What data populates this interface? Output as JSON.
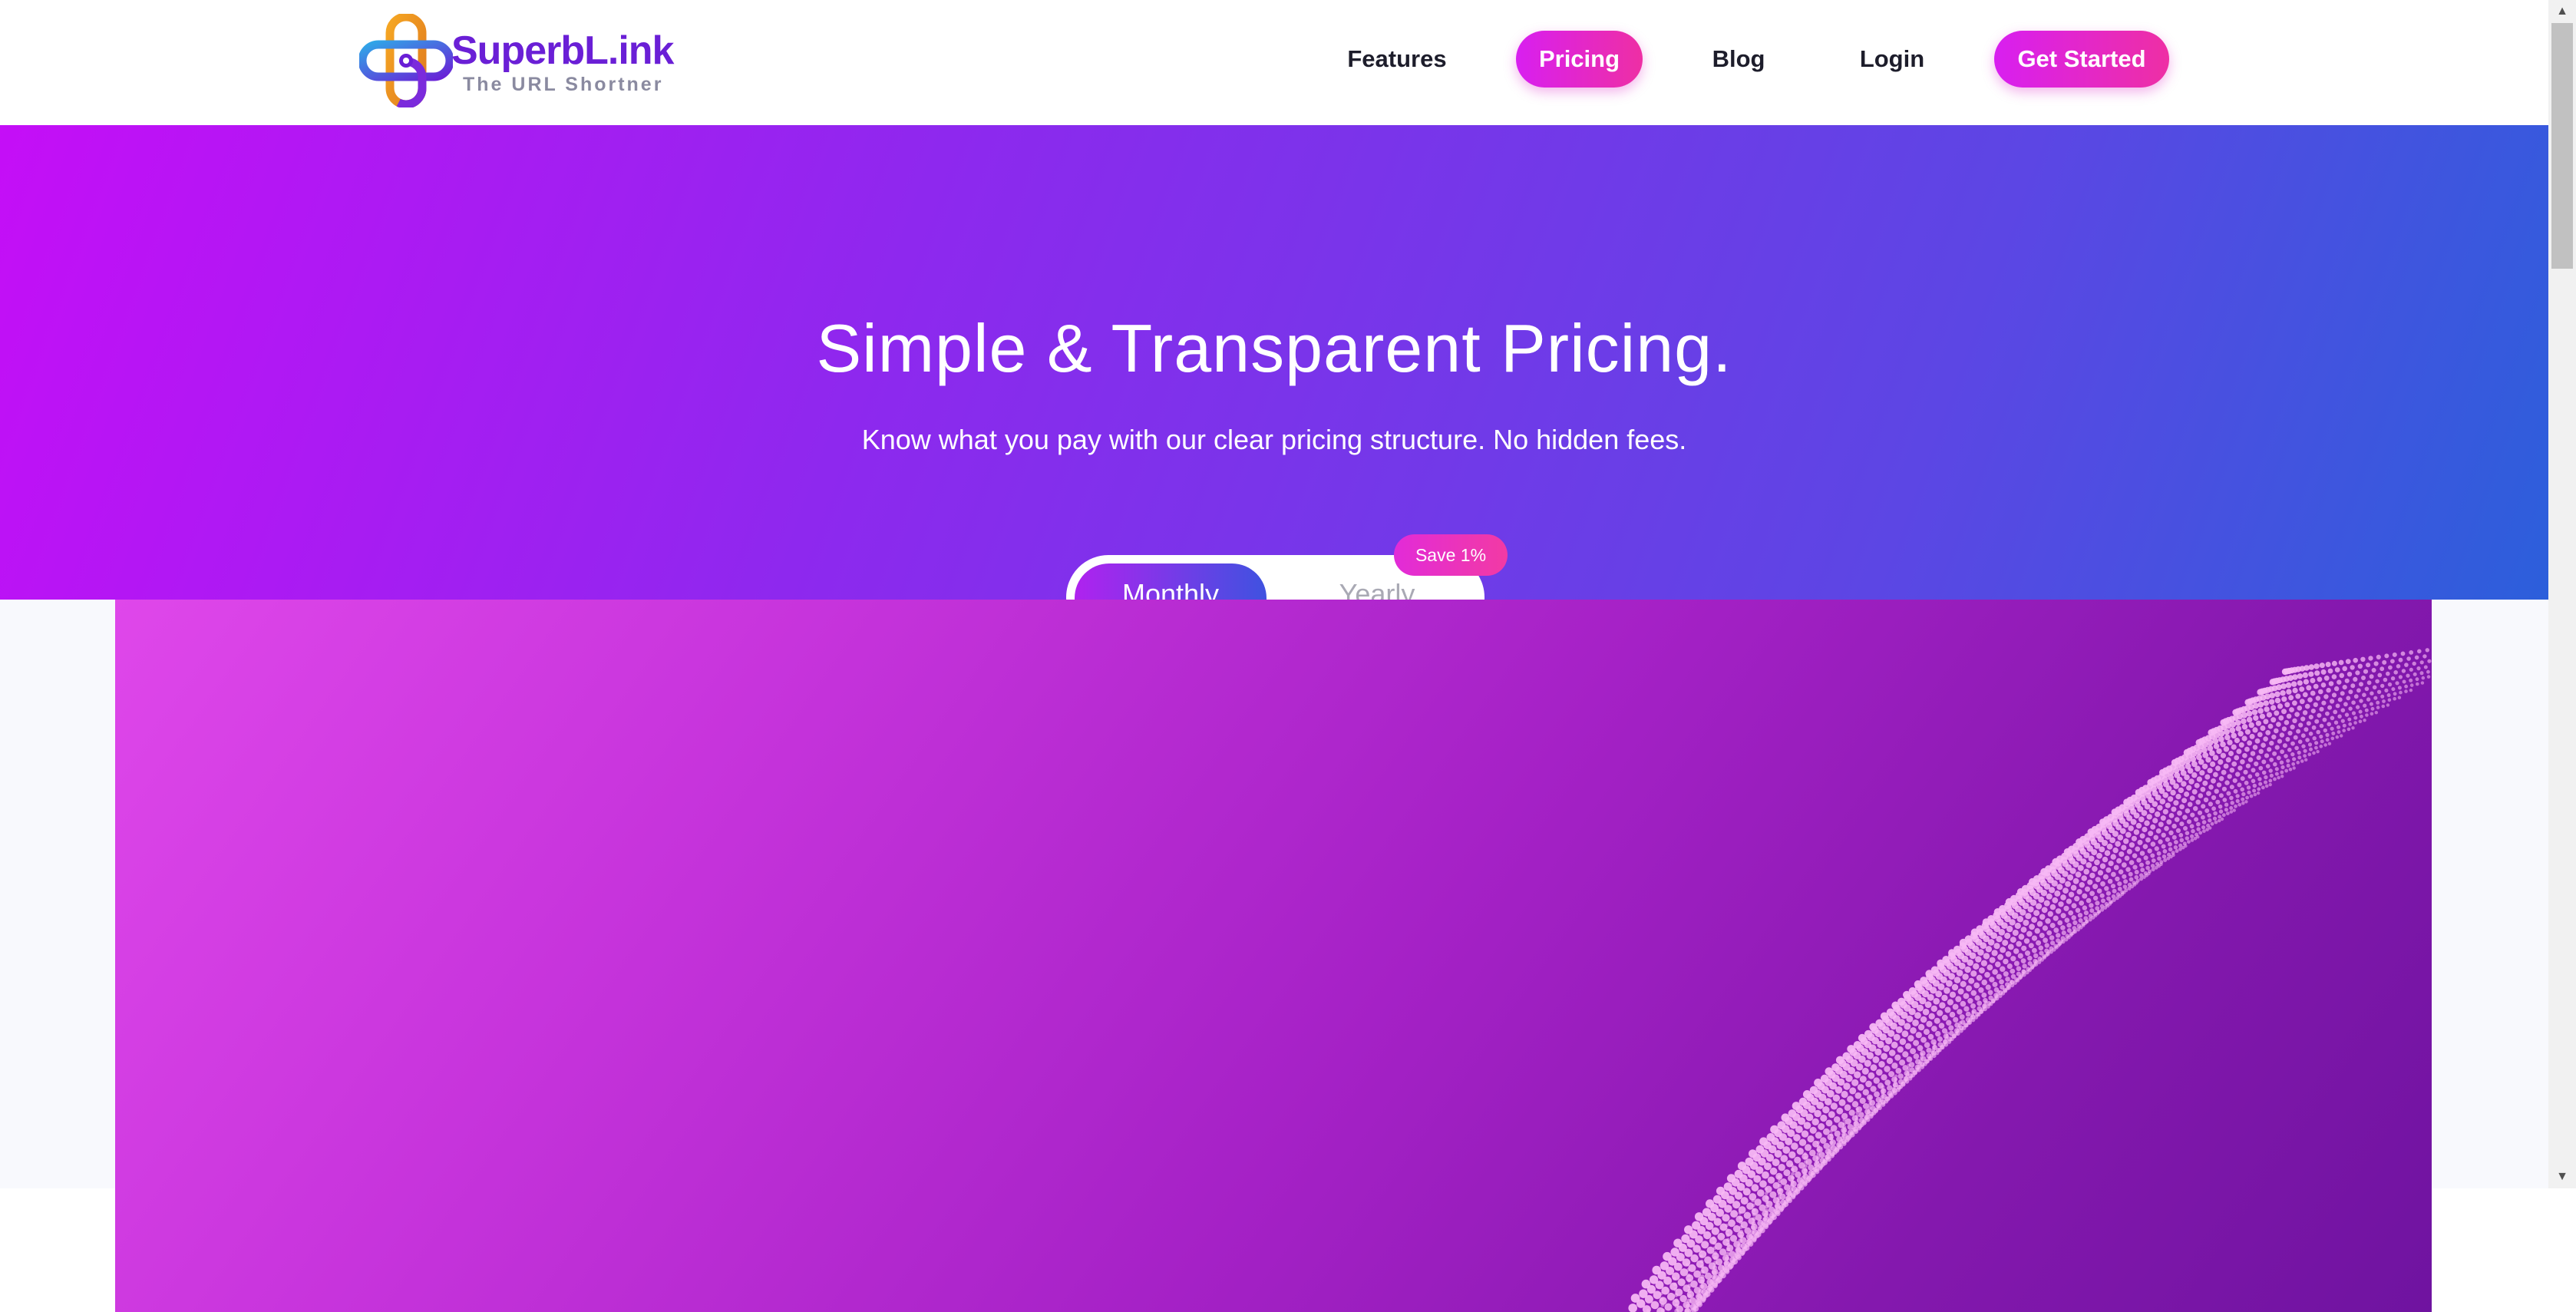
{
  "brand": {
    "name": "SuperbL.ink",
    "tagline": "The URL Shortner",
    "colors": {
      "primary_gradient": [
        "#d81ff0",
        "#ee2fa4"
      ],
      "hero_gradient": [
        "#c50ef7",
        "#2c5fdb"
      ],
      "logo_text": "#6a1fd6"
    }
  },
  "nav": {
    "features": "Features",
    "pricing": "Pricing",
    "blog": "Blog",
    "login": "Login",
    "cta": "Get Started",
    "active": "Pricing"
  },
  "hero": {
    "title": "Simple & Transparent Pricing.",
    "subtitle": "Know what you pay with our clear pricing structure. No hidden fees."
  },
  "billing_toggle": {
    "monthly": "Monthly",
    "yearly": "Yearly",
    "selected": "Monthly",
    "save_badge": "Save 1%"
  },
  "icons": {
    "logo": "chain-link-logo-icon",
    "scroll_up": "chevron-up-icon",
    "scroll_down": "chevron-down-icon"
  }
}
